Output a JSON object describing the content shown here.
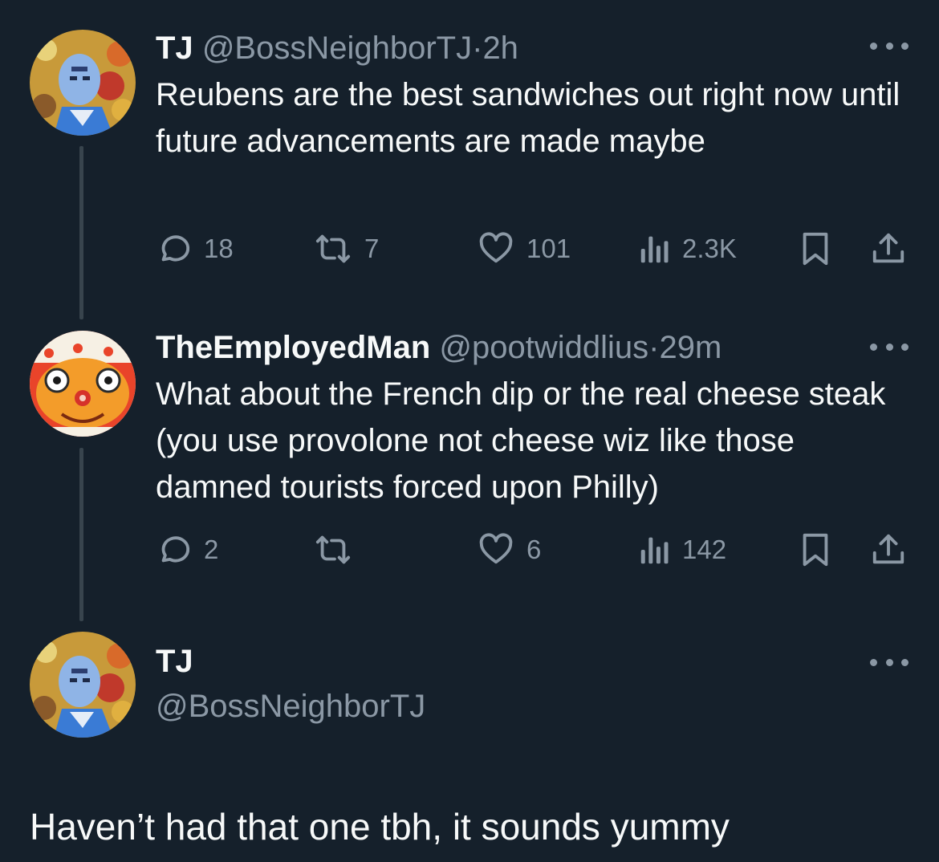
{
  "tweets": [
    {
      "name": "TJ",
      "handle": "@BossNeighborTJ",
      "separator": "·",
      "time": "2h",
      "text": "Reubens are the best sandwiches out right now until future advancements are made maybe",
      "stats": {
        "replies": "18",
        "reposts": "7",
        "likes": "101",
        "views": "2.3K"
      }
    },
    {
      "name": "TheEmployedMan",
      "handle": "@pootwiddlius",
      "separator": "·",
      "time": "29m",
      "text": "What about the French dip or the real cheese steak (you use provolone not cheese wiz like those damned tourists forced upon Philly)",
      "stats": {
        "replies": "2",
        "reposts": "",
        "likes": "6",
        "views": "142"
      }
    }
  ],
  "focused": {
    "name": "TJ",
    "handle": "@BossNeighborTJ",
    "text": "Haven’t had that one tbh, it sounds yummy"
  },
  "colors": {
    "background": "#15202b",
    "text_primary": "#f7f9f9",
    "text_secondary": "#8b98a5",
    "thread_line": "#38444d"
  },
  "icons": [
    "reply-icon",
    "repost-icon",
    "like-icon",
    "views-icon",
    "bookmark-icon",
    "share-icon",
    "more-icon"
  ]
}
